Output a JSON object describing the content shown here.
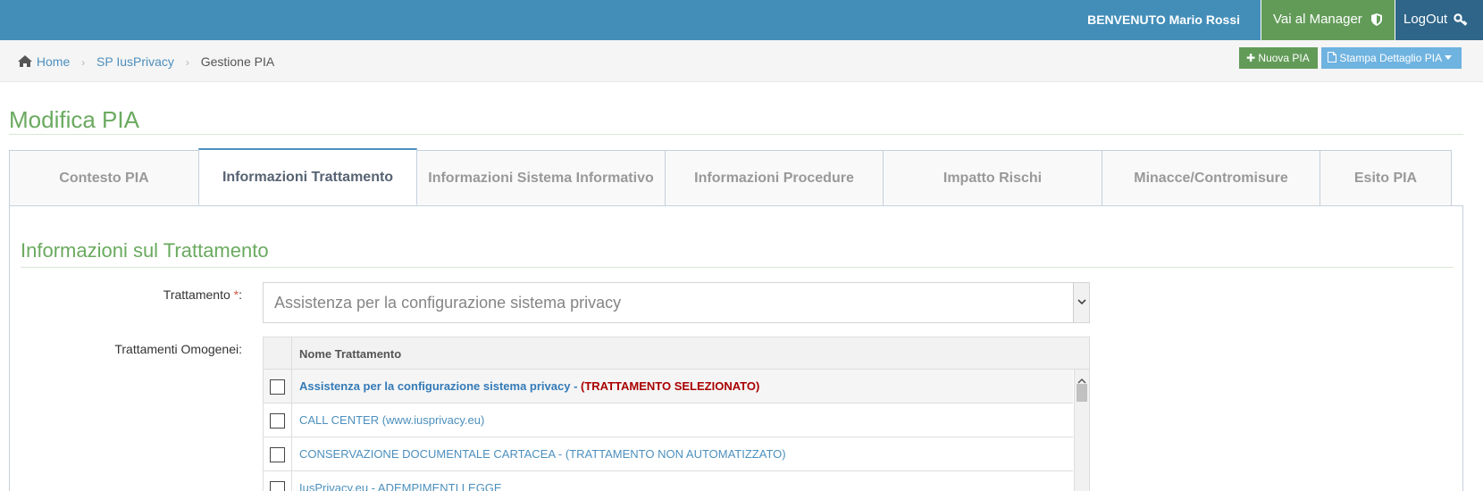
{
  "header": {
    "welcome": "BENVENUTO Mario Rossi",
    "manager_label": "Vai al Manager",
    "logout_label": "LogOut"
  },
  "breadcrumb": {
    "home": "Home",
    "level1": "SP IusPrivacy",
    "current": "Gestione PIA"
  },
  "actions": {
    "new_label": "Nuova PIA",
    "print_label": "Stampa Dettaglio PIA"
  },
  "page": {
    "title": "Modifica PIA"
  },
  "tabs": [
    {
      "label": "Contesto PIA"
    },
    {
      "label": "Informazioni Trattamento"
    },
    {
      "label": "Informazioni Sistema Informativo"
    },
    {
      "label": "Informazioni Procedure"
    },
    {
      "label": "Impatto Rischi"
    },
    {
      "label": "Minacce/Contromisure"
    },
    {
      "label": "Esito PIA"
    }
  ],
  "active_tab": "Informazioni Trattamento",
  "section": {
    "title": "Informazioni sul Trattamento",
    "trattamento_label": "Trattamento ",
    "trattamento_required": "*",
    "trattamento_colon": ":",
    "trattamento_value": "Assistenza per la configurazione sistema privacy",
    "omogenei_label": "Trattamenti Omogenei:"
  },
  "table": {
    "column": "Nome Trattamento",
    "rows": [
      {
        "name": "Assistenza per la configurazione sistema privacy",
        "suffix": " - ",
        "tag": "(TRATTAMENTO SELEZIONATO)",
        "checked": false
      },
      {
        "name": "CALL CENTER (www.iusprivacy.eu)",
        "checked": false
      },
      {
        "name": "CONSERVAZIONE DOCUMENTALE CARTACEA - (TRATTAMENTO NON AUTOMATIZZATO)",
        "checked": false
      },
      {
        "name": "IusPrivacy.eu - ADEMPIMENTI LEGGE",
        "checked": false
      }
    ]
  },
  "colors": {
    "topbar": "#438eb9",
    "manager": "#629b58",
    "logout": "#2e6589",
    "accent_green": "#6aaa5f",
    "link": "#4c8fbd",
    "selected_tag": "#aa0000"
  },
  "icons": [
    "home-icon",
    "shield-icon",
    "key-icon",
    "plus-icon",
    "file-icon",
    "caret-down-icon",
    "chevron-down-icon",
    "chevron-up-icon"
  ]
}
